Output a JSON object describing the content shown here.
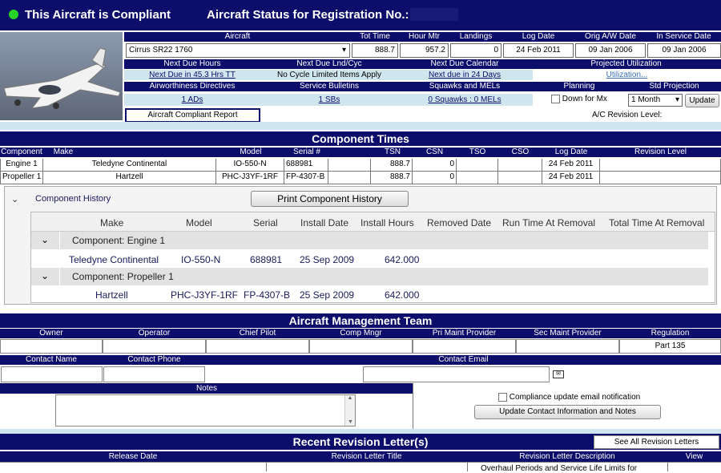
{
  "banner": {
    "compliant": "This Aircraft is Compliant",
    "status_title": "Aircraft Status for Registration No.:"
  },
  "summary": {
    "headers": {
      "aircraft": "Aircraft",
      "tot_time": "Tot Time",
      "hour_mtr": "Hour Mtr",
      "landings": "Landings",
      "log_date": "Log Date",
      "orig_aw_date": "Orig A/W Date",
      "in_service_date": "In Service Date"
    },
    "aircraft_select": "Cirrus SR22 1760",
    "tot_time": "888.7",
    "hour_mtr": "957.2",
    "landings": "0",
    "log_date": "24 Feb 2011",
    "orig_aw_date": "09 Jan 2006",
    "in_service_date": "09 Jan 2006",
    "headers2": {
      "next_due_hours": "Next Due Hours",
      "next_due_lnd": "Next Due Lnd/Cyc",
      "next_due_cal": "Next Due Calendar",
      "projected": "Projected Utilization"
    },
    "next_due_hours": "Next Due in 45.3 Hrs TT",
    "next_due_lnd": "No Cycle Limited Items Apply",
    "next_due_cal": "Next due in 24 Days",
    "projected": "Utilization...",
    "headers3": {
      "ad": "Airworthiness Directives",
      "sb": "Service Bulletins",
      "squawks": "Squawks and MELs",
      "planning": "Planning",
      "std_projection": "Std Projection"
    },
    "ads": "1 ADs",
    "sbs": "1 SBs",
    "squawks": "0 Squawks : 0 MELs",
    "down_for_mx": "Down for Mx",
    "projection_select": "1 Month",
    "update_button": "Update",
    "compliant_report_button": "Aircraft Compliant Report",
    "revision_level_label": "A/C Revision Level:"
  },
  "component_times": {
    "title": "Component Times",
    "headers": [
      "Component",
      "Make",
      "Model",
      "Serial #",
      "TSN",
      "CSN",
      "TSO",
      "CSO",
      "Log Date",
      "Revision Level"
    ],
    "rows": [
      {
        "component": "Engine 1",
        "make": "Teledyne Continental",
        "model": "IO-550-N",
        "serial": "688981",
        "tsn": "888.7",
        "csn": "0",
        "tso": "",
        "cso": "",
        "log_date": "24 Feb 2011",
        "revision": ""
      },
      {
        "component": "Propeller 1",
        "make": "Hartzell",
        "model": "PHC-J3YF-1RF",
        "serial": "FP-4307-B",
        "tsn": "888.7",
        "csn": "0",
        "tso": "",
        "cso": "",
        "log_date": "24 Feb 2011",
        "revision": ""
      }
    ]
  },
  "component_history": {
    "label": "Component History",
    "print_button": "Print Component History",
    "headers": [
      "Make",
      "Model",
      "Serial",
      "Install Date",
      "Install Hours",
      "Removed Date",
      "Run Time At Removal",
      "Total Time At Removal"
    ],
    "groups": [
      {
        "title": "Component: Engine 1",
        "make": "Teledyne Continental",
        "model": "IO-550-N",
        "serial": "688981",
        "install_date": "25 Sep 2009",
        "install_hours": "642.000"
      },
      {
        "title": "Component: Propeller 1",
        "make": "Hartzell",
        "model": "PHC-J3YF-1RF",
        "serial": "FP-4307-B",
        "install_date": "25 Sep 2009",
        "install_hours": "642.000"
      }
    ]
  },
  "management": {
    "title": "Aircraft Management Team",
    "headers": [
      "Owner",
      "Operator",
      "Chief Pilot",
      "Comp Mngr",
      "Pri Maint Provider",
      "Sec Maint Provider",
      "Regulation"
    ],
    "regulation": "Part 135",
    "contact_name": "Contact Name",
    "contact_phone": "Contact Phone",
    "contact_email": "Contact Email",
    "notes": "Notes",
    "compliance_email": "Compliance update email notification",
    "update_contact_button": "Update Contact Information and Notes"
  },
  "revisions": {
    "title": "Recent Revision Letter(s)",
    "see_all_button": "See All Revision Letters",
    "headers": [
      "Release Date",
      "Revision Letter Title",
      "Revision Letter Description",
      "View"
    ],
    "first_desc": "Overhaul Periods and Service Life Limits for"
  }
}
